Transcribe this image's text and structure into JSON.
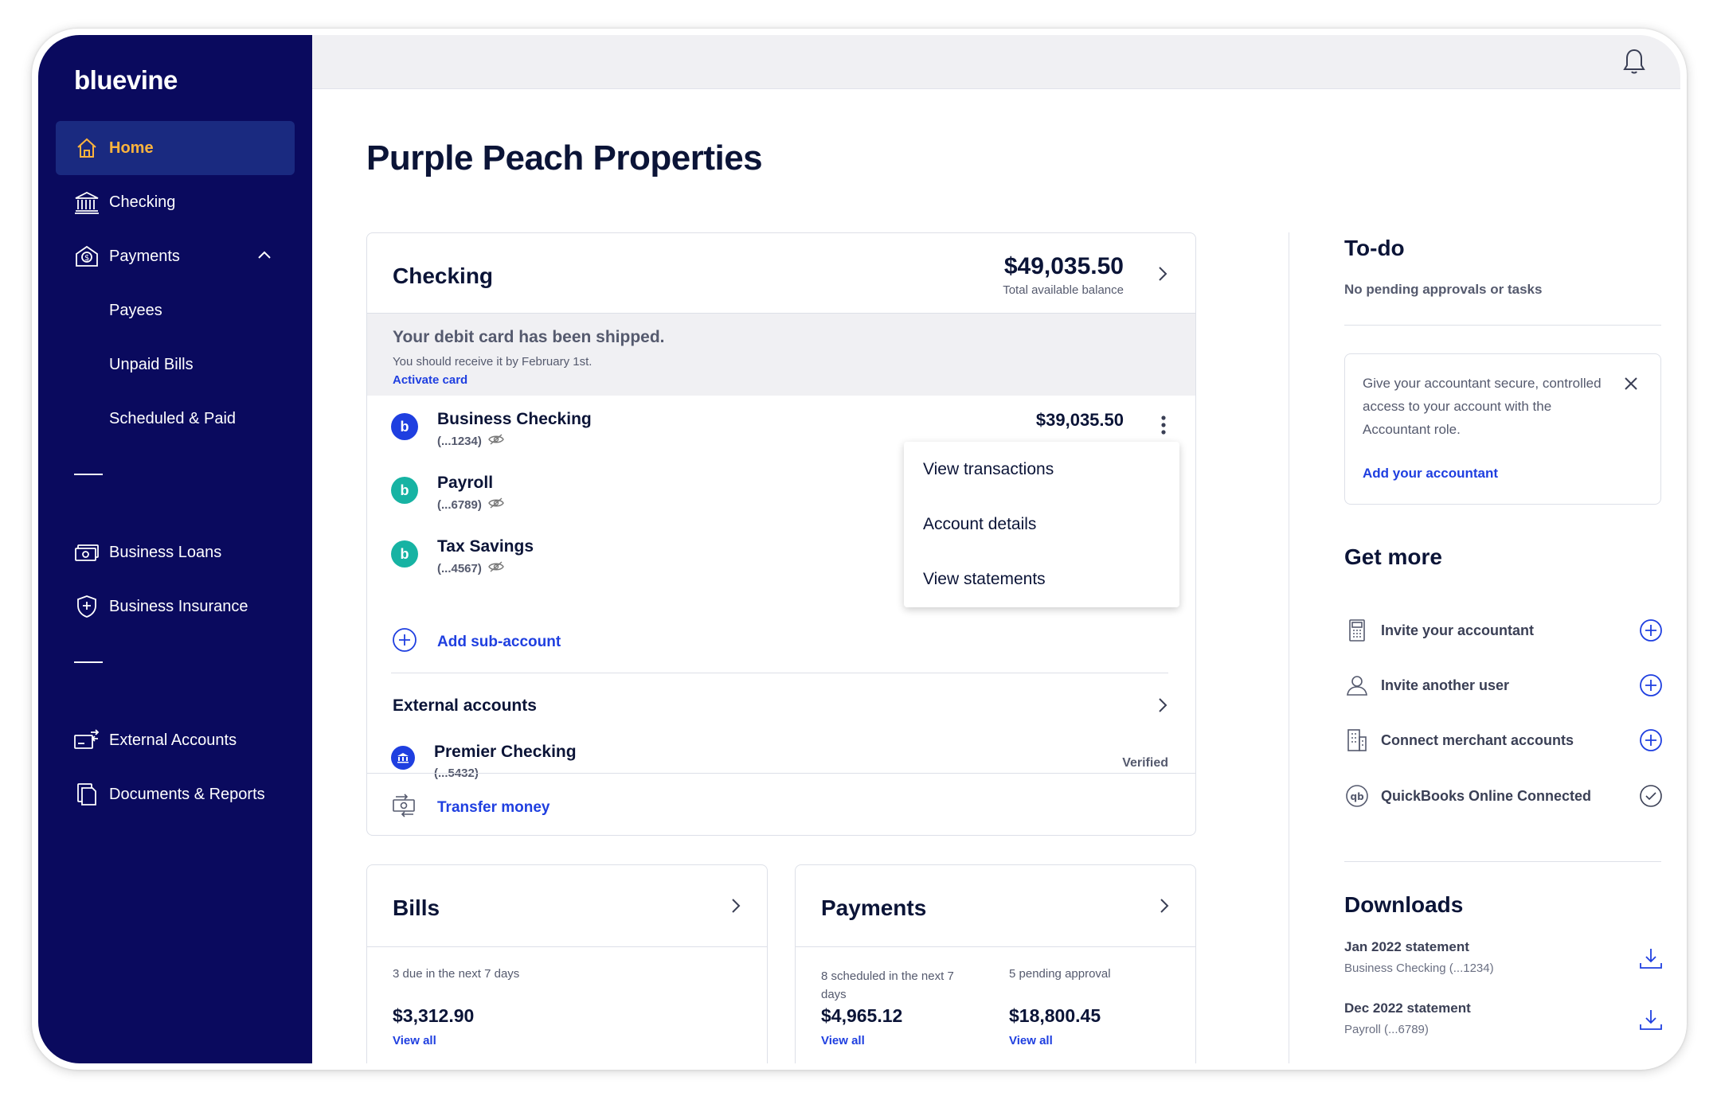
{
  "brand": {
    "logo": "bluevine"
  },
  "sidebar": {
    "items": [
      {
        "label": "Home",
        "icon": "home-icon",
        "active": true
      },
      {
        "label": "Checking",
        "icon": "bank-icon"
      },
      {
        "label": "Payments",
        "icon": "payments-icon",
        "expanded": true
      },
      {
        "label": "Payees"
      },
      {
        "label": "Unpaid Bills"
      },
      {
        "label": "Scheduled & Paid"
      },
      {
        "label": "Business Loans",
        "icon": "loans-icon"
      },
      {
        "label": "Business Insurance",
        "icon": "shield-icon"
      },
      {
        "label": "External Accounts",
        "icon": "external-accounts-icon"
      },
      {
        "label": "Documents & Reports",
        "icon": "documents-icon"
      }
    ]
  },
  "page": {
    "title": "Purple Peach Properties"
  },
  "checking": {
    "title": "Checking",
    "balance": "$49,035.50",
    "balance_label": "Total available balance",
    "notice_title": "Your debit card has been shipped.",
    "notice_text": "You should receive it by February 1st.",
    "notice_link": "Activate card",
    "accounts": [
      {
        "name": "Business Checking",
        "number": "(...1234)",
        "balance": "$39,035.50",
        "color": "#1f3fe0"
      },
      {
        "name": "Payroll",
        "number": "(...6789)",
        "color": "#17b3a3"
      },
      {
        "name": "Tax Savings",
        "number": "(...4567)",
        "color": "#17b3a3"
      }
    ],
    "add_sub": "Add sub-account",
    "menu": [
      "View transactions",
      "Account details",
      "View statements"
    ],
    "external_title": "External accounts",
    "external": {
      "name": "Premier Checking",
      "number": "(...5432)",
      "status": "Verified"
    },
    "transfer": "Transfer money"
  },
  "bills": {
    "title": "Bills",
    "caption": "3 due in the next 7 days",
    "amount": "$3,312.90",
    "link": "View all"
  },
  "payments": {
    "title": "Payments",
    "scheduled_caption": "8 scheduled in the next 7 days",
    "scheduled_amount": "$4,965.12",
    "scheduled_link": "View all",
    "pending_caption": "5 pending approval",
    "pending_amount": "$18,800.45",
    "pending_link": "View all"
  },
  "todo": {
    "title": "To-do",
    "text": "No pending approvals or tasks",
    "promo_text": "Give your accountant secure, controlled access to your account with the Accountant role.",
    "promo_link": "Add your accountant"
  },
  "get_more": {
    "title": "Get more",
    "items": [
      {
        "label": "Invite your accountant",
        "icon": "calculator-icon",
        "action": "plus"
      },
      {
        "label": "Invite another user",
        "icon": "user-icon",
        "action": "plus"
      },
      {
        "label": "Connect merchant accounts",
        "icon": "building-icon",
        "action": "plus"
      },
      {
        "label": "QuickBooks Online Connected",
        "icon": "quickbooks-icon",
        "action": "check"
      }
    ]
  },
  "downloads": {
    "title": "Downloads",
    "items": [
      {
        "title": "Jan 2022 statement",
        "sub": "Business Checking (...1234)"
      },
      {
        "title": "Dec 2022 statement",
        "sub": "Payroll (...6789)"
      }
    ]
  },
  "colors": {
    "sidebar": "#0a0a5e",
    "active_nav": "#1a2a80",
    "accent": "#ffb43d",
    "link": "#1f3fe0",
    "teal": "#17b3a3"
  }
}
